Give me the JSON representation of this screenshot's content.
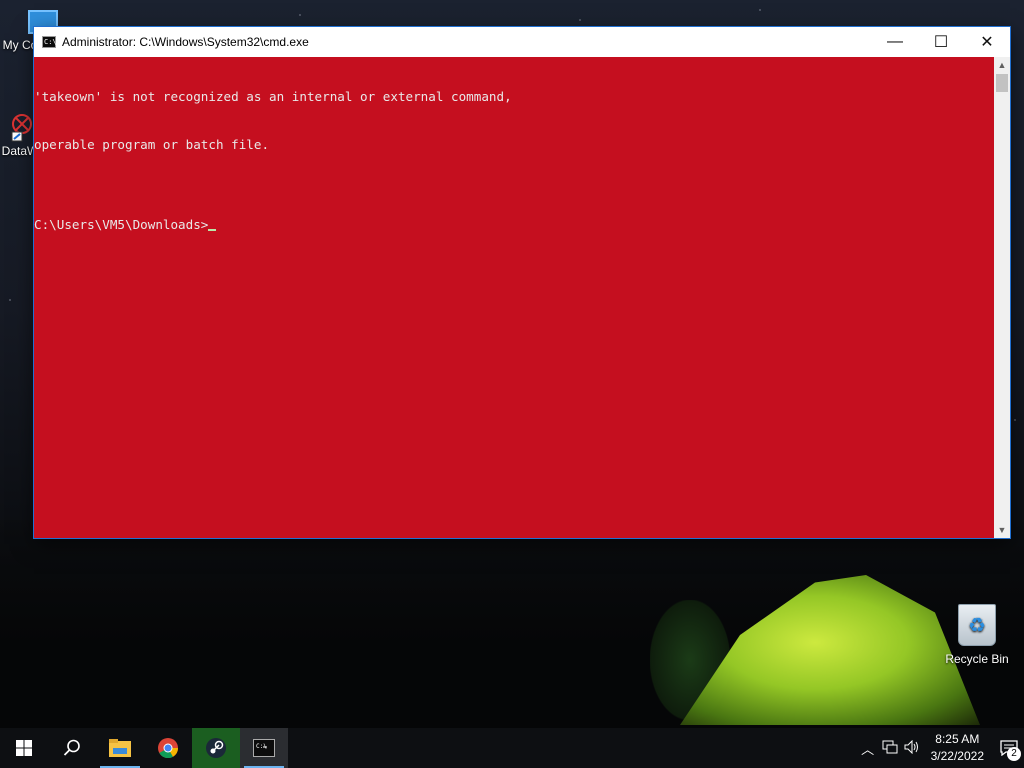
{
  "desktop": {
    "icons": [
      {
        "label": "My Co"
      },
      {
        "label": "DataW"
      },
      {
        "label": "Recycle Bin"
      }
    ]
  },
  "window": {
    "title": "Administrator: C:\\Windows\\System32\\cmd.exe",
    "icon_glyph": "C:\\_",
    "controls": {
      "minimize": "—",
      "maximize": "☐",
      "close": "✕"
    },
    "background_color": "#c50f1f",
    "console_lines": [
      "'takeown' is not recognized as an internal or external command,",
      "operable program or batch file.",
      "",
      "C:\\Users\\VM5\\Downloads>"
    ]
  },
  "taskbar": {
    "items": [
      {
        "name": "start-icon"
      },
      {
        "name": "search-icon"
      },
      {
        "name": "file-explorer-icon"
      },
      {
        "name": "chrome-icon"
      },
      {
        "name": "steam-icon"
      },
      {
        "name": "cmd-icon"
      }
    ],
    "tray": {
      "time": "8:25 AM",
      "date": "3/22/2022",
      "notification_count": "2"
    }
  }
}
